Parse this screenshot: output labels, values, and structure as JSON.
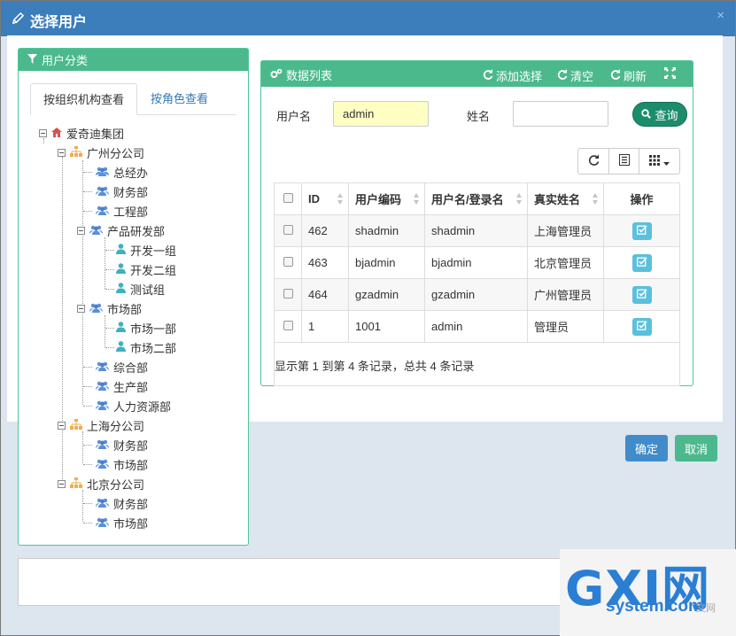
{
  "modal": {
    "title": "选择用户",
    "close": "×",
    "confirm_label": "确定",
    "cancel_label": "取消"
  },
  "left_panel": {
    "title": "用户分类",
    "tabs": [
      "按组织机构查看",
      "按角色查看"
    ],
    "tree": {
      "root": "爱奇迪集团",
      "guangzhou": "广州分公司",
      "gz_zongjingban": "总经办",
      "gz_caiwubu": "财务部",
      "gz_gongchengbu": "工程部",
      "gz_chanpin": "产品研发部",
      "gz_kaifa1": "开发一组",
      "gz_kaifa2": "开发二组",
      "gz_ceshi": "测试组",
      "gz_shichang": "市场部",
      "gz_shichang1": "市场一部",
      "gz_shichang2": "市场二部",
      "gz_zonghe": "综合部",
      "gz_shengchan": "生产部",
      "gz_renli": "人力资源部",
      "shanghai": "上海分公司",
      "sh_caiwu": "财务部",
      "sh_shichang": "市场部",
      "beijing": "北京分公司",
      "bj_caiwu": "财务部",
      "bj_shichang": "市场部"
    }
  },
  "right_panel": {
    "title": "数据列表",
    "tools": {
      "add": "添加选择",
      "clear": "清空",
      "refresh": "刷新"
    },
    "search": {
      "username_label": "用户名",
      "username_value": "admin",
      "realname_label": "姓名",
      "realname_value": "",
      "query_label": "查询"
    },
    "table": {
      "headers": [
        "ID",
        "用户编码",
        "用户名/登录名",
        "真实姓名",
        "操作"
      ],
      "rows": [
        {
          "id": "462",
          "code": "shadmin",
          "login": "shadmin",
          "name": "上海管理员"
        },
        {
          "id": "463",
          "code": "bjadmin",
          "login": "bjadmin",
          "name": "北京管理员"
        },
        {
          "id": "464",
          "code": "gzadmin",
          "login": "gzadmin",
          "name": "广州管理员"
        },
        {
          "id": "1",
          "code": "1001",
          "login": "admin",
          "name": "管理员"
        }
      ]
    },
    "pager_text": "显示第 1 到第 4 条记录，总共 4 条记录"
  },
  "watermark": {
    "main": "GXI网",
    "sub": "system.com",
    "small": "文网"
  },
  "colors": {
    "header_blue": "#3c7dbb",
    "panel_green": "#4cb98d",
    "query_green": "#1c8c6c",
    "confirm_blue": "#428bca",
    "edit_cyan": "#5bc0de"
  }
}
